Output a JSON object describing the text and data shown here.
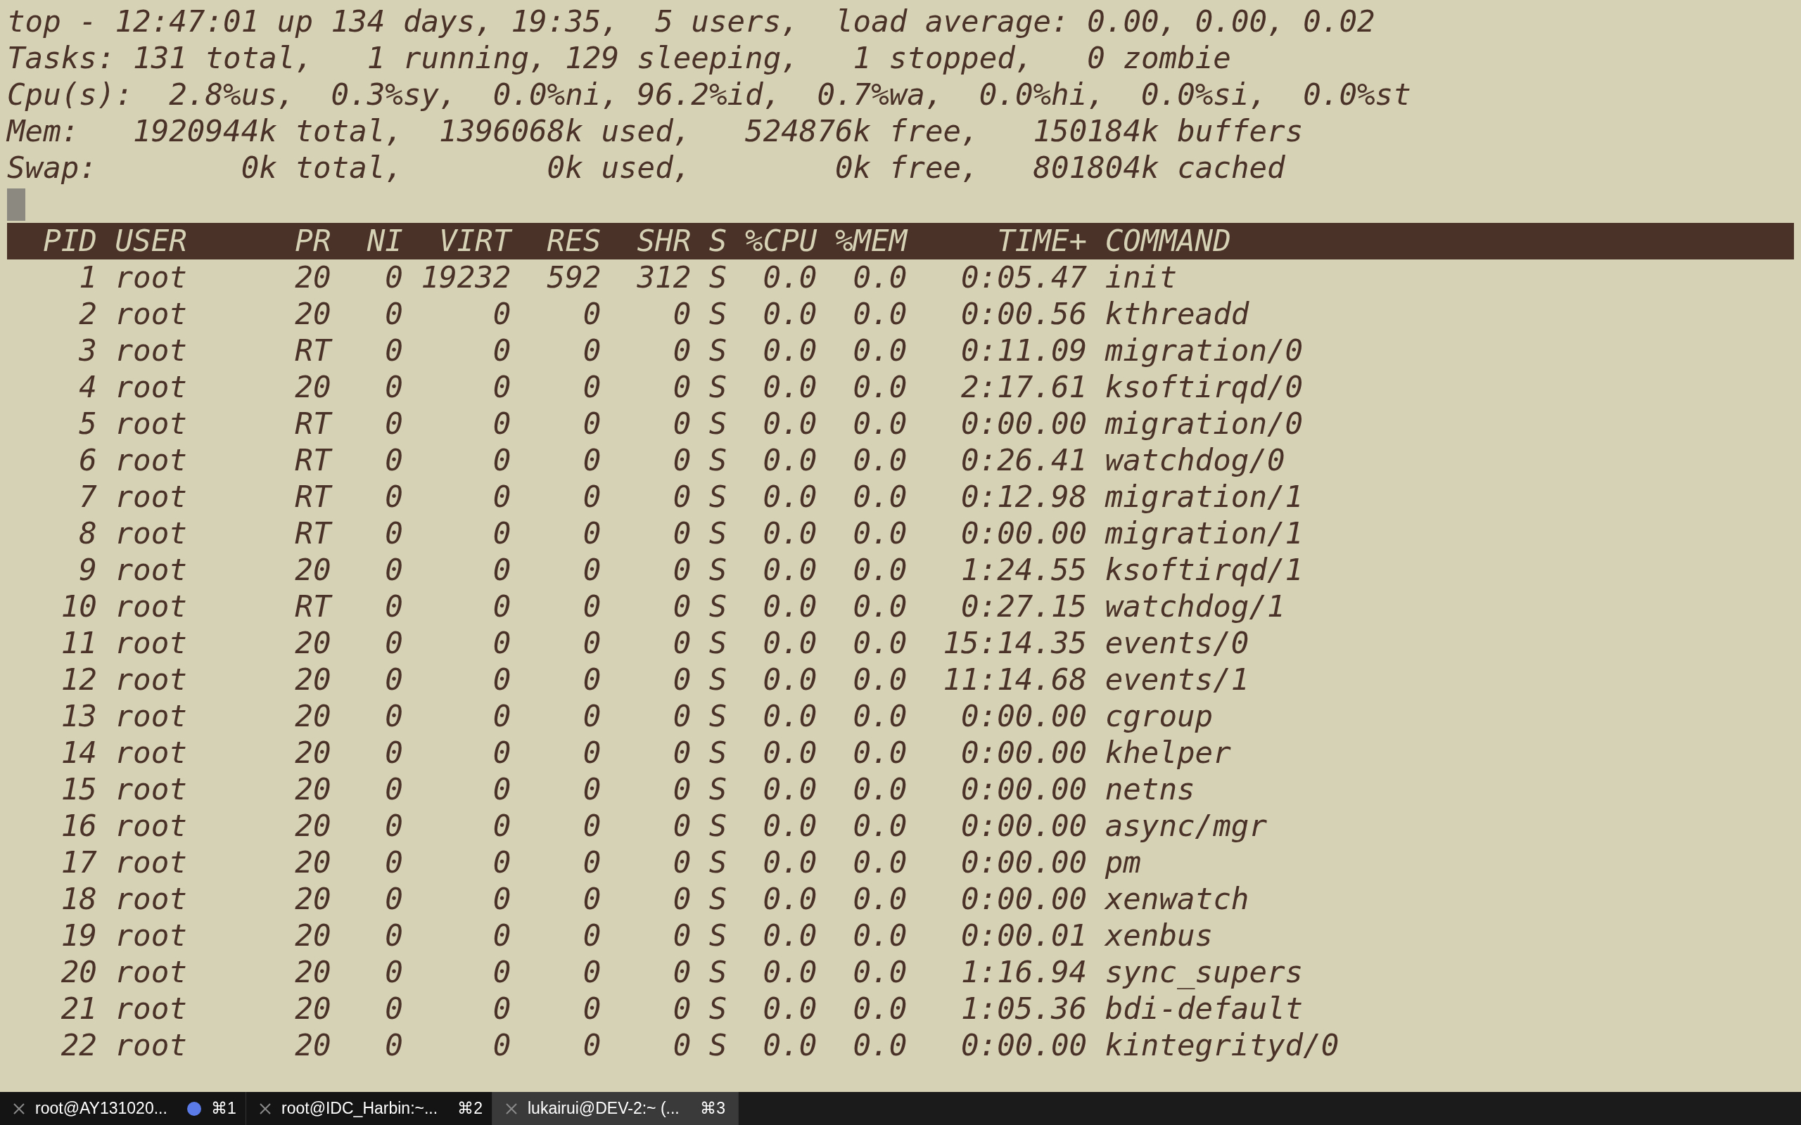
{
  "summary_lines": [
    "top - 12:47:01 up 134 days, 19:35,  5 users,  load average: 0.00, 0.00, 0.02",
    "Tasks: 131 total,   1 running, 129 sleeping,   1 stopped,   0 zombie",
    "Cpu(s):  2.8%us,  0.3%sy,  0.0%ni, 96.2%id,  0.7%wa,  0.0%hi,  0.0%si,  0.0%st",
    "Mem:   1920944k total,  1396068k used,   524876k free,   150184k buffers",
    "Swap:        0k total,        0k used,        0k free,   801804k cached"
  ],
  "table": {
    "columns": [
      "PID",
      "USER",
      "PR",
      "NI",
      "VIRT",
      "RES",
      "SHR",
      "S",
      "%CPU",
      "%MEM",
      "TIME+",
      "COMMAND"
    ],
    "rows": [
      [
        "1",
        "root",
        "20",
        "0",
        "19232",
        "592",
        "312",
        "S",
        "0.0",
        "0.0",
        "0:05.47",
        "init"
      ],
      [
        "2",
        "root",
        "20",
        "0",
        "0",
        "0",
        "0",
        "S",
        "0.0",
        "0.0",
        "0:00.56",
        "kthreadd"
      ],
      [
        "3",
        "root",
        "RT",
        "0",
        "0",
        "0",
        "0",
        "S",
        "0.0",
        "0.0",
        "0:11.09",
        "migration/0"
      ],
      [
        "4",
        "root",
        "20",
        "0",
        "0",
        "0",
        "0",
        "S",
        "0.0",
        "0.0",
        "2:17.61",
        "ksoftirqd/0"
      ],
      [
        "5",
        "root",
        "RT",
        "0",
        "0",
        "0",
        "0",
        "S",
        "0.0",
        "0.0",
        "0:00.00",
        "migration/0"
      ],
      [
        "6",
        "root",
        "RT",
        "0",
        "0",
        "0",
        "0",
        "S",
        "0.0",
        "0.0",
        "0:26.41",
        "watchdog/0"
      ],
      [
        "7",
        "root",
        "RT",
        "0",
        "0",
        "0",
        "0",
        "S",
        "0.0",
        "0.0",
        "0:12.98",
        "migration/1"
      ],
      [
        "8",
        "root",
        "RT",
        "0",
        "0",
        "0",
        "0",
        "S",
        "0.0",
        "0.0",
        "0:00.00",
        "migration/1"
      ],
      [
        "9",
        "root",
        "20",
        "0",
        "0",
        "0",
        "0",
        "S",
        "0.0",
        "0.0",
        "1:24.55",
        "ksoftirqd/1"
      ],
      [
        "10",
        "root",
        "RT",
        "0",
        "0",
        "0",
        "0",
        "S",
        "0.0",
        "0.0",
        "0:27.15",
        "watchdog/1"
      ],
      [
        "11",
        "root",
        "20",
        "0",
        "0",
        "0",
        "0",
        "S",
        "0.0",
        "0.0",
        "15:14.35",
        "events/0"
      ],
      [
        "12",
        "root",
        "20",
        "0",
        "0",
        "0",
        "0",
        "S",
        "0.0",
        "0.0",
        "11:14.68",
        "events/1"
      ],
      [
        "13",
        "root",
        "20",
        "0",
        "0",
        "0",
        "0",
        "S",
        "0.0",
        "0.0",
        "0:00.00",
        "cgroup"
      ],
      [
        "14",
        "root",
        "20",
        "0",
        "0",
        "0",
        "0",
        "S",
        "0.0",
        "0.0",
        "0:00.00",
        "khelper"
      ],
      [
        "15",
        "root",
        "20",
        "0",
        "0",
        "0",
        "0",
        "S",
        "0.0",
        "0.0",
        "0:00.00",
        "netns"
      ],
      [
        "16",
        "root",
        "20",
        "0",
        "0",
        "0",
        "0",
        "S",
        "0.0",
        "0.0",
        "0:00.00",
        "async/mgr"
      ],
      [
        "17",
        "root",
        "20",
        "0",
        "0",
        "0",
        "0",
        "S",
        "0.0",
        "0.0",
        "0:00.00",
        "pm"
      ],
      [
        "18",
        "root",
        "20",
        "0",
        "0",
        "0",
        "0",
        "S",
        "0.0",
        "0.0",
        "0:00.00",
        "xenwatch"
      ],
      [
        "19",
        "root",
        "20",
        "0",
        "0",
        "0",
        "0",
        "S",
        "0.0",
        "0.0",
        "0:00.01",
        "xenbus"
      ],
      [
        "20",
        "root",
        "20",
        "0",
        "0",
        "0",
        "0",
        "S",
        "0.0",
        "0.0",
        "1:16.94",
        "sync_supers"
      ],
      [
        "21",
        "root",
        "20",
        "0",
        "0",
        "0",
        "0",
        "S",
        "0.0",
        "0.0",
        "1:05.36",
        "bdi-default"
      ],
      [
        "22",
        "root",
        "20",
        "0",
        "0",
        "0",
        "0",
        "S",
        "0.0",
        "0.0",
        "0:00.00",
        "kintegrityd/0"
      ]
    ]
  },
  "tabs": [
    {
      "title": "root@AY131020...",
      "shortcut": "⌘1",
      "activity": true,
      "selected": false
    },
    {
      "title": "root@IDC_Harbin:~...",
      "shortcut": "⌘2",
      "activity": false,
      "selected": false
    },
    {
      "title": "lukairui@DEV-2:~ (...",
      "shortcut": "⌘3",
      "activity": false,
      "selected": true
    }
  ]
}
